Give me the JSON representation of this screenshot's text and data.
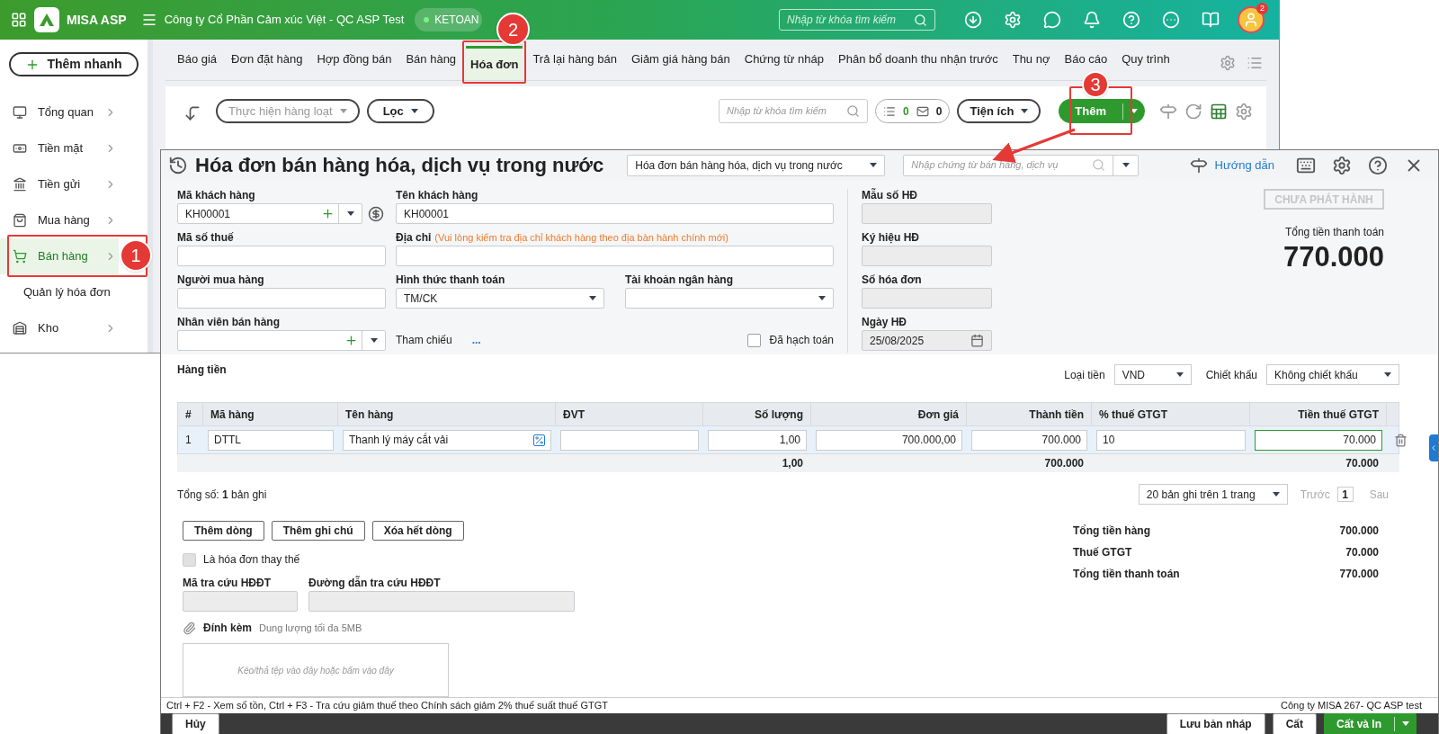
{
  "app": {
    "logo": "MISA ASP",
    "company": "Công ty Cổ Phần Cảm xúc Việt - QC ASP Test",
    "user": "KETOAN",
    "search": {
      "placeholder": "Nhập từ khóa tìm kiếm"
    },
    "notification_count": "2"
  },
  "sidebar": {
    "add_button": "Thêm nhanh",
    "items": [
      {
        "label": "Tổng quan",
        "selected": false
      },
      {
        "label": "Tiền mặt",
        "selected": false
      },
      {
        "label": "Tiền gửi",
        "selected": false
      },
      {
        "label": "Mua hàng",
        "selected": false
      },
      {
        "label": "Bán hàng",
        "selected": true
      },
      {
        "label": "Quản lý hóa đơn",
        "selected": false
      },
      {
        "label": "Kho",
        "selected": false
      }
    ]
  },
  "tabs": [
    {
      "label": "Báo giá",
      "selected": false
    },
    {
      "label": "Đơn đặt hàng",
      "selected": false
    },
    {
      "label": "Hợp đồng bán",
      "selected": false
    },
    {
      "label": "Bán hàng",
      "selected": false
    },
    {
      "label": "Hóa đơn",
      "selected": true
    },
    {
      "label": "Trả lại hàng bán",
      "selected": false
    },
    {
      "label": "Giảm giá hàng bán",
      "selected": false
    },
    {
      "label": "Chứng từ nháp",
      "selected": false
    },
    {
      "label": "Phân bổ doanh thu nhận trước",
      "selected": false
    },
    {
      "label": "Thu nợ",
      "selected": false
    },
    {
      "label": "Báo cáo",
      "selected": false
    },
    {
      "label": "Quy trình",
      "selected": false
    }
  ],
  "toolbar": {
    "batch": "Thực hiện hàng loạt",
    "filter": "Lọc",
    "search": {
      "placeholder": "Nhập từ khóa tìm kiếm"
    },
    "doc_count": "0",
    "mail_count": "0",
    "utilities": "Tiện ích",
    "add": "Thêm"
  },
  "annotations": [
    "1",
    "2",
    "3"
  ],
  "dialog": {
    "title": "Hóa đơn bán hàng hóa, dịch vụ trong nước",
    "type": "Hóa đơn bán hàng hóa, dịch vụ trong nước",
    "search": {
      "placeholder": "Nhập chứng từ bán hàng, dịch vụ"
    },
    "guide": "Hướng dẫn",
    "customer_code": {
      "label": "Mã khách hàng",
      "value": "KH00001"
    },
    "customer_name": {
      "label": "Tên khách hàng",
      "value": "KH00001"
    },
    "tax_code": {
      "label": "Mã số thuế"
    },
    "address": {
      "label": "Địa chỉ",
      "note": "(Vui lòng kiểm tra địa chỉ khách hàng theo địa bàn hành chính mới)"
    },
    "buyer": {
      "label": "Người mua hàng"
    },
    "payment": {
      "label": "Hình thức thanh toán",
      "value": "TM/CK"
    },
    "bank": {
      "label": "Tài khoản ngân hàng"
    },
    "staff": {
      "label": "Nhân viên bán hàng"
    },
    "reference": {
      "label": "Tham chiếu",
      "link": "..."
    },
    "posted": {
      "label": "Đã hạch toán",
      "checked": false
    },
    "invoice_form": {
      "label": "Mẫu số HĐ"
    },
    "invoice_symbol": {
      "label": "Ký hiệu HĐ"
    },
    "invoice_number": {
      "label": "Số hóa đơn"
    },
    "invoice_date": {
      "label": "Ngày HĐ",
      "value": "25/08/2025"
    },
    "status": "CHƯA PHÁT HÀNH",
    "total_label": "Tổng tiền thanh toán",
    "total": "770.000",
    "section": "Hàng tiền",
    "currency": {
      "label": "Loại tiền",
      "value": "VND"
    },
    "discount": {
      "label": "Chiết khấu",
      "value": "Không chiết khấu"
    },
    "table": {
      "columns": [
        {
          "label": "#",
          "kind": "text"
        },
        {
          "label": "Mã hàng",
          "kind": "text"
        },
        {
          "label": "Tên hàng",
          "kind": "text"
        },
        {
          "label": "ĐVT",
          "kind": "text"
        },
        {
          "label": "Số lượng",
          "kind": "number"
        },
        {
          "label": "Đơn giá",
          "kind": "number"
        },
        {
          "label": "Thành tiền",
          "kind": "number"
        },
        {
          "label": "% thuế GTGT",
          "kind": "text"
        },
        {
          "label": "Tiền thuế GTGT",
          "kind": "number"
        }
      ],
      "rows": [
        [
          "1",
          "DTTL",
          "Thanh lý máy cắt vải",
          "",
          "1,00",
          "700.000,00",
          "700.000",
          "10",
          "70.000"
        ]
      ],
      "totals": {
        "quantity": "1,00",
        "amount": "700.000",
        "tax": "70.000"
      }
    },
    "record_count": "Tổng số: **1** bản ghi",
    "page_size": "20 bản ghi trên 1 trang",
    "prev": "Trước",
    "page": "1",
    "next": "Sau",
    "row_buttons": [
      "Thêm dòng",
      "Thêm ghi chú",
      "Xóa hết dòng"
    ],
    "replacement": {
      "label": "Là hóa đơn thay thế",
      "checked": false
    },
    "lookup_code": {
      "label": "Mã tra cứu HĐĐT"
    },
    "lookup_link": {
      "label": "Đường dẫn tra cứu HĐĐT"
    },
    "attach": {
      "label": "Đính kèm",
      "note": "Dung lượng tối đa 5MB",
      "drop": "Kéo/thả tệp vào đây hoặc bấm vào đây"
    },
    "summary": [
      {
        "label": "Tổng tiền hàng",
        "value": "700.000"
      },
      {
        "label": "Thuế GTGT",
        "value": "70.000"
      },
      {
        "label": "Tổng tiền thanh toán",
        "value": "770.000"
      }
    ],
    "hint": "Ctrl + F2 - Xem số tồn, Ctrl + F3 - Tra cứu giảm thuế theo Chính sách giảm 2% thuế suất thuế GTGT",
    "company": "Công ty MISA 267- QC ASP test",
    "footer": {
      "cancel": "Hủy",
      "draft": "Lưu bản nháp",
      "save": "Cất",
      "save_print": "Cất và In"
    }
  }
}
